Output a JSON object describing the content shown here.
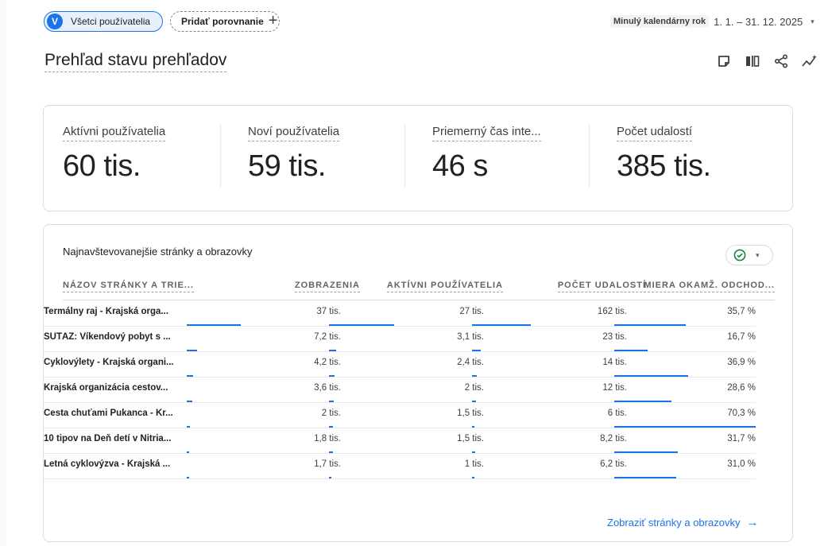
{
  "comparison": {
    "all_users_avatar": "V",
    "all_users_label": "Všetci používatelia",
    "add_comparison_label": "Pridať porovnanie",
    "add_icon": "+"
  },
  "date_range": {
    "label": "Minulý kalendárny rok",
    "value": "1. 1. – 31. 12. 2025",
    "caret": "▾"
  },
  "report_title": "Prehľad stavu prehľadov",
  "toolbar_icons": [
    "edit-note-icon",
    "compare-columns-icon",
    "share-icon",
    "insights-icon"
  ],
  "metrics": [
    {
      "label": "Aktívni používatelia",
      "value": "60 tis."
    },
    {
      "label": "Noví používatelia",
      "value": "59 tis."
    },
    {
      "label": "Priemerný čas inte...",
      "value": "46 s"
    },
    {
      "label": "Počet udalostí",
      "value": "385 tis."
    }
  ],
  "table_card": {
    "title": "Najnavštevovanejšie stránky a obrazovky",
    "status_caret": "▾",
    "headers": [
      "NÁZOV STRÁNKY A TRIE...",
      "ZOBRAZENIA",
      "AKTÍVNI POUŽÍVATELIA",
      "POČET UDALOSTÍ",
      "MIERA OKAMŽ. ODCHOD..."
    ],
    "rows": [
      {
        "name": "Termálny raj - Krajská orga...",
        "views": "37 tis.",
        "active": "27 tis.",
        "events": "162 tis.",
        "bounce": "35,7 %",
        "views_fraction": 1.0,
        "active_fraction": 1.0,
        "events_fraction": 1.0,
        "bounce_fraction": 0.508
      },
      {
        "name": "SÚŤAŽ: Víkendový pobyt s ...",
        "views": "7,2 tis.",
        "active": "3,1 tis.",
        "events": "23 tis.",
        "bounce": "16,7 %",
        "views_fraction": 0.195,
        "active_fraction": 0.115,
        "events_fraction": 0.142,
        "bounce_fraction": 0.238
      },
      {
        "name": "Cyklovýlety - Krajská organi...",
        "views": "4,2 tis.",
        "active": "2,4 tis.",
        "events": "14 tis.",
        "bounce": "36,9 %",
        "views_fraction": 0.114,
        "active_fraction": 0.089,
        "events_fraction": 0.086,
        "bounce_fraction": 0.525
      },
      {
        "name": "Krajská organizácia cestov...",
        "views": "3,6 tis.",
        "active": "2 tis.",
        "events": "12 tis.",
        "bounce": "28,6 %",
        "views_fraction": 0.097,
        "active_fraction": 0.074,
        "events_fraction": 0.074,
        "bounce_fraction": 0.407
      },
      {
        "name": "Cesta chuťami Pukanca - Kr...",
        "views": "2 tis.",
        "active": "1,5 tis.",
        "events": "6 tis.",
        "bounce": "70,3 %",
        "views_fraction": 0.054,
        "active_fraction": 0.056,
        "events_fraction": 0.037,
        "bounce_fraction": 1.0
      },
      {
        "name": "10 tipov na Deň detí v Nitria...",
        "views": "1,8 tis.",
        "active": "1,5 tis.",
        "events": "8,2 tis.",
        "bounce": "31,7 %",
        "views_fraction": 0.049,
        "active_fraction": 0.056,
        "events_fraction": 0.051,
        "bounce_fraction": 0.451
      },
      {
        "name": "Letná cyklovýzva - Krajská ...",
        "views": "1,7 tis.",
        "active": "1 tis.",
        "events": "6,2 tis.",
        "bounce": "31,0 %",
        "views_fraction": 0.046,
        "active_fraction": 0.037,
        "events_fraction": 0.038,
        "bounce_fraction": 0.441
      }
    ],
    "view_link": "Zobraziť stránky a obrazovky",
    "view_link_arrow": "→"
  },
  "colors": {
    "accent": "#1a73e8",
    "check_green": "#188038"
  }
}
